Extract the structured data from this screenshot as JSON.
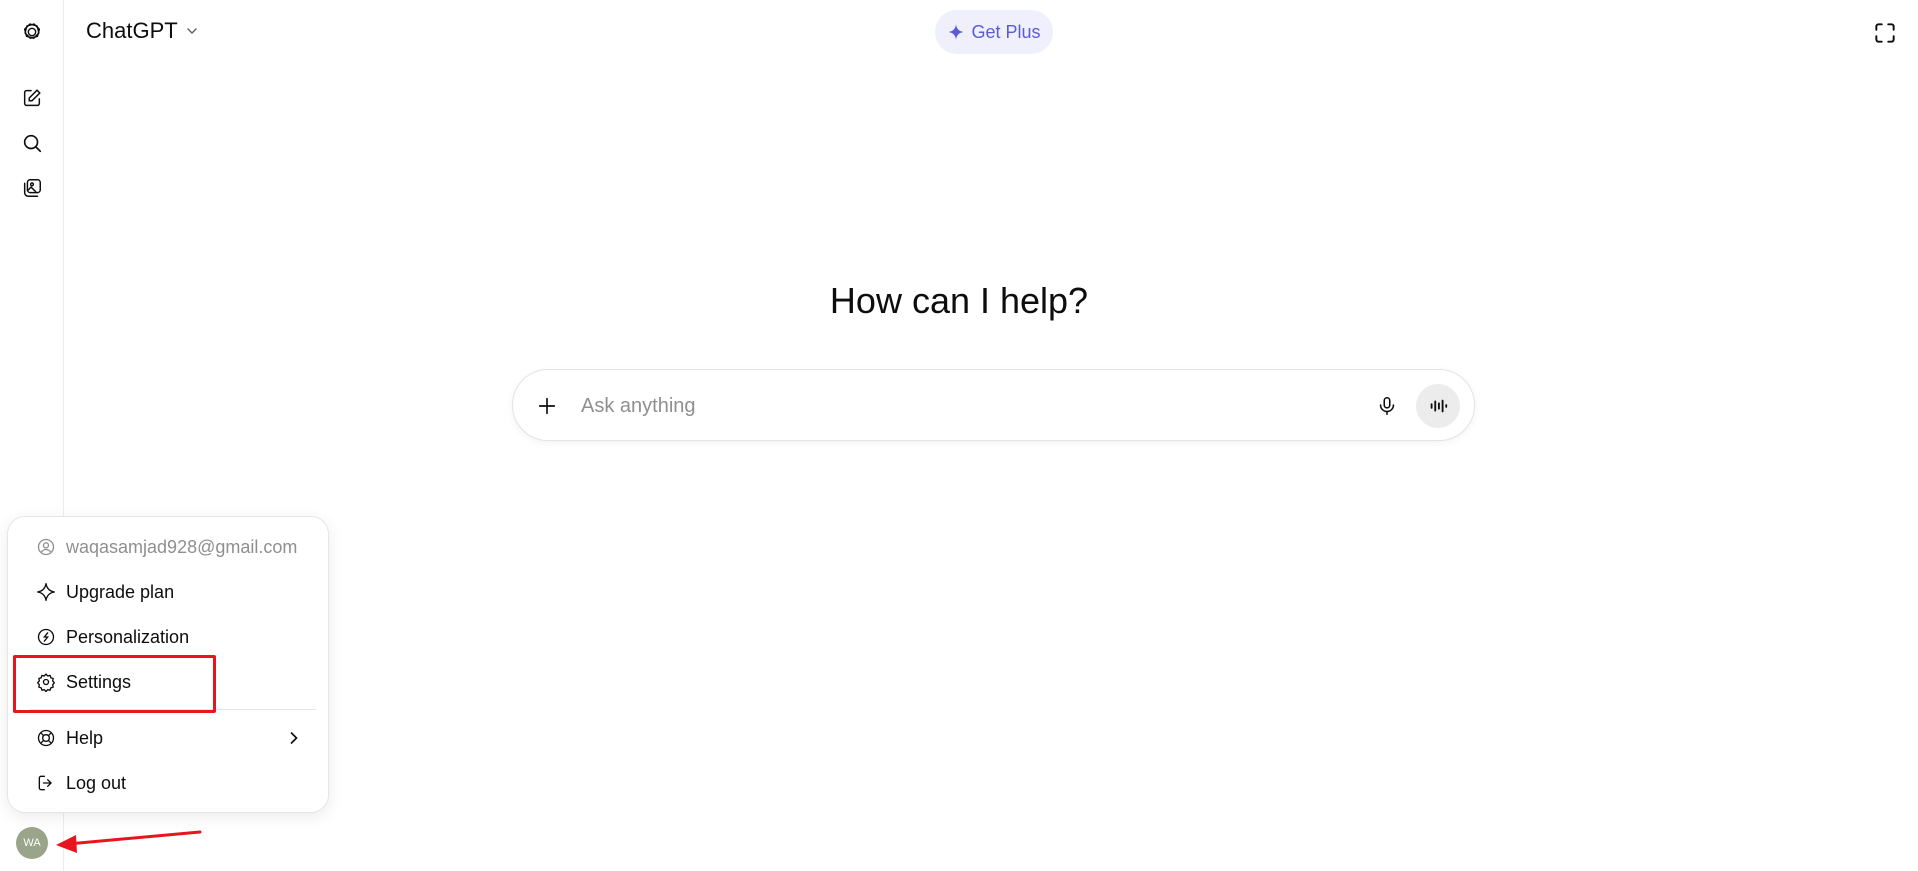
{
  "header": {
    "model_name": "ChatGPT",
    "get_plus_label": "Get Plus"
  },
  "main": {
    "heading": "How can I help?",
    "composer_placeholder": "Ask anything"
  },
  "account_menu": {
    "email": "waqasamjad928@gmail.com",
    "items": [
      {
        "label": "Upgrade plan",
        "icon": "sparkle-icon"
      },
      {
        "label": "Personalization",
        "icon": "personalization-icon"
      },
      {
        "label": "Settings",
        "icon": "gear-icon"
      },
      {
        "label": "Help",
        "icon": "lifebuoy-icon"
      },
      {
        "label": "Log out",
        "icon": "logout-icon"
      }
    ]
  },
  "user": {
    "initials": "WA"
  },
  "colors": {
    "accent_plus": "#5b5bd6",
    "annotation_red": "#e8161c",
    "avatar_bg": "#9aa48a"
  }
}
